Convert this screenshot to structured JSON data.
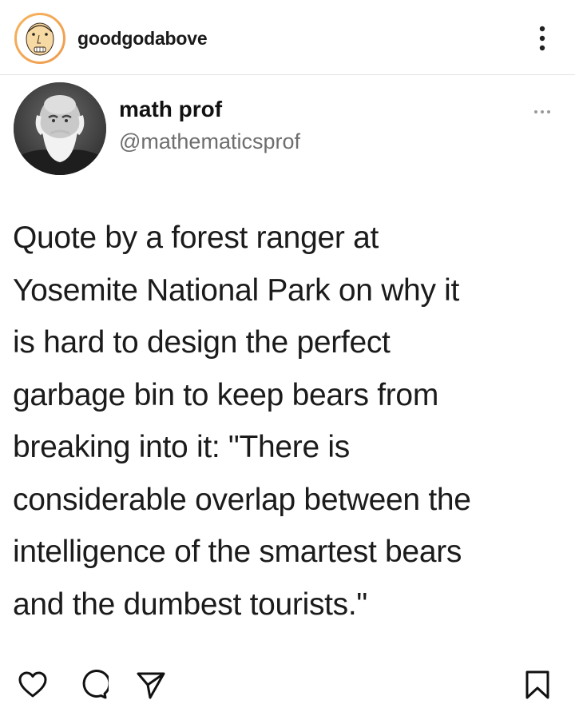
{
  "post_header": {
    "username": "goodgodabove",
    "avatar_icon": "cartoon-face-avatar-icon",
    "menu_icon": "more-vertical-icon"
  },
  "tweet": {
    "display_name": "math prof",
    "handle": "@mathematicsprof",
    "more_icon": "more-horizontal-icon",
    "text": "Quote by a forest ranger at\nYosemite National Park on why it\nis hard to design the perfect\ngarbage bin to keep bears from\nbreaking into it:  \"There is\nconsiderable overlap between the\nintelligence of the smartest bears\nand the dumbest tourists.\""
  },
  "actions": {
    "like_icon": "heart-icon",
    "comment_icon": "comment-icon",
    "share_icon": "paper-plane-icon",
    "save_icon": "bookmark-icon"
  },
  "colors": {
    "avatar_ring": "#f2a55a",
    "text": "#111111",
    "handle": "#6e6e6e",
    "divider": "#e3e3e3"
  }
}
